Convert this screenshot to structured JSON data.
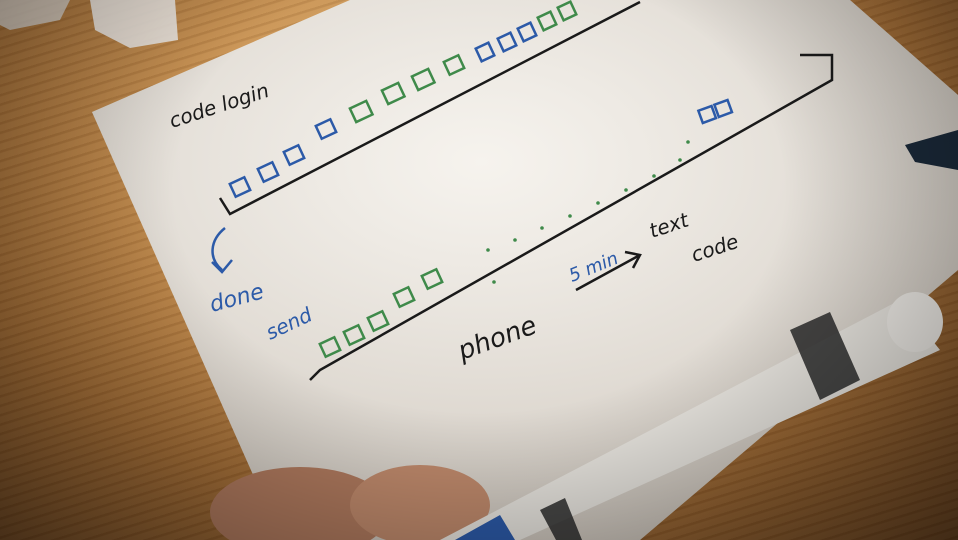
{
  "sheet": {
    "title": "code login",
    "note_done": "done",
    "note_send": "send",
    "note_phone": "phone",
    "note_timer": "5 min",
    "note_text_code": "text",
    "note_text_code_2": "code"
  },
  "colors": {
    "blue_ink": "#2c5aa8",
    "green_ink": "#3f8a4a",
    "black_ink": "#1a1a1a",
    "paper": "#f3efe8",
    "desk": "#c58e4f"
  },
  "objects": {
    "marker": "marker-icon",
    "hand": "hand-icon"
  }
}
